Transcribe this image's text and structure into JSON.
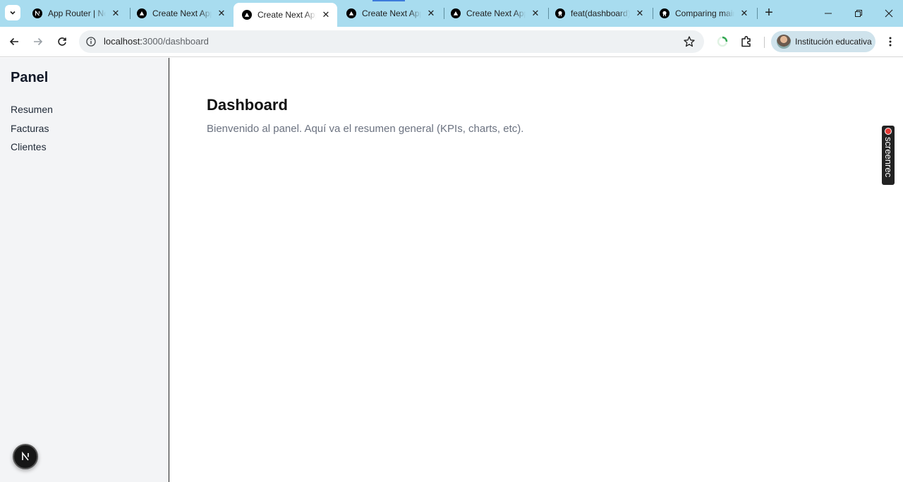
{
  "browser": {
    "tabs": [
      {
        "title": "App Router | Ne",
        "favicon": "nextjs-icon",
        "active": false
      },
      {
        "title": "Create Next App",
        "favicon": "vercel-triangle-icon",
        "active": false
      },
      {
        "title": "Create Next App",
        "favicon": "vercel-triangle-icon",
        "active": true
      },
      {
        "title": "Create Next App",
        "favicon": "vercel-triangle-icon",
        "active": false
      },
      {
        "title": "Create Next App",
        "favicon": "vercel-triangle-icon",
        "active": false
      },
      {
        "title": "feat(dashboard)",
        "favicon": "github-icon",
        "active": false
      },
      {
        "title": "Comparing mair",
        "favicon": "github-icon",
        "active": false
      }
    ],
    "address": {
      "host": "localhost:",
      "path": "3000/dashboard"
    },
    "profile_label": "Institución educativa",
    "colors": {
      "tabstrip": "#a8dcef",
      "omnibox": "#eef1f3",
      "profile_chip": "#cfe3ec"
    }
  },
  "sidebar": {
    "brand": "Panel",
    "items": [
      {
        "label": "Resumen"
      },
      {
        "label": "Facturas"
      },
      {
        "label": "Clientes"
      }
    ]
  },
  "main": {
    "title": "Dashboard",
    "description": "Bienvenido al panel. Aquí va el resumen general (KPIs, charts, etc)."
  },
  "overlays": {
    "next_badge": "N",
    "screenrec_label": "screenrec"
  }
}
